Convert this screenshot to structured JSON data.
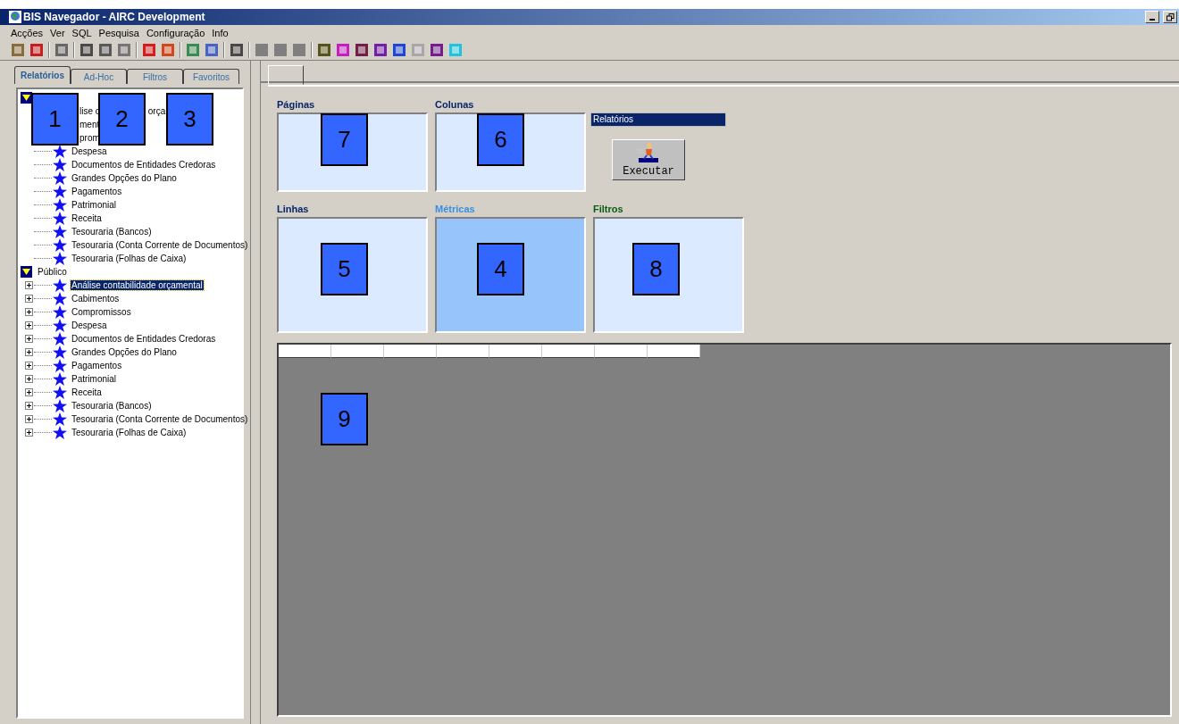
{
  "window": {
    "title": "BIS Navegador - AIRC Development"
  },
  "menu": [
    "Acções",
    "Ver",
    "SQL",
    "Pesquisa",
    "Configuração",
    "Info"
  ],
  "left_tabs": [
    {
      "label": "Relatórios",
      "selected": true
    },
    {
      "label": "Ad-Hoc",
      "selected": false
    },
    {
      "label": "Filtros",
      "selected": false
    },
    {
      "label": "Favoritos",
      "selected": false
    }
  ],
  "tree": [
    {
      "expanded": true,
      "children": [
        {
          "kind": "partial",
          "fragments": [
            "lise c",
            "orça"
          ],
          "selected": false
        },
        {
          "kind": "partial",
          "fragments": [
            "ment"
          ],
          "selected": false
        },
        {
          "kind": "partial",
          "fragments": [
            "prom"
          ],
          "selected": false
        },
        {
          "kind": "report",
          "label": "Despesa",
          "selected": false
        },
        {
          "kind": "report",
          "label": "Documentos de Entidades Credoras",
          "selected": false
        },
        {
          "kind": "report",
          "label": "Grandes Opções do Plano",
          "selected": false
        },
        {
          "kind": "report",
          "label": "Pagamentos",
          "selected": false
        },
        {
          "kind": "report",
          "label": "Patrimonial",
          "selected": false
        },
        {
          "kind": "report",
          "label": "Receita",
          "selected": false
        },
        {
          "kind": "report",
          "label": "Tesouraria (Bancos)",
          "selected": false
        },
        {
          "kind": "report",
          "label": "Tesouraria (Conta Corrente de Documentos)",
          "selected": false
        },
        {
          "kind": "report",
          "label": "Tesouraria (Folhas de Caixa)",
          "selected": false
        }
      ]
    },
    {
      "label": "Público",
      "expanded": true,
      "children": [
        {
          "kind": "report",
          "label": "Análise contabilidade orçamental",
          "selected": true,
          "collapsed": true
        },
        {
          "kind": "report",
          "label": "Cabimentos",
          "selected": false,
          "collapsed": true
        },
        {
          "kind": "report",
          "label": "Compromissos",
          "selected": false,
          "collapsed": true
        },
        {
          "kind": "report",
          "label": "Despesa",
          "selected": false,
          "collapsed": true
        },
        {
          "kind": "report",
          "label": "Documentos de Entidades Credoras",
          "selected": false,
          "collapsed": true
        },
        {
          "kind": "report",
          "label": "Grandes Opções do Plano",
          "selected": false,
          "collapsed": true
        },
        {
          "kind": "report",
          "label": "Pagamentos",
          "selected": false,
          "collapsed": true
        },
        {
          "kind": "report",
          "label": "Patrimonial",
          "selected": false,
          "collapsed": true
        },
        {
          "kind": "report",
          "label": "Receita",
          "selected": false,
          "collapsed": true
        },
        {
          "kind": "report",
          "label": "Tesouraria (Bancos)",
          "selected": false,
          "collapsed": true
        },
        {
          "kind": "report",
          "label": "Tesouraria (Conta Corrente de Documentos)",
          "selected": false,
          "collapsed": true
        },
        {
          "kind": "report",
          "label": "Tesouraria (Folhas de Caixa)",
          "selected": false,
          "collapsed": true
        }
      ]
    }
  ],
  "zones_top": [
    {
      "label": "Páginas",
      "color": "#0a246a",
      "selected": false
    },
    {
      "label": "Colunas",
      "color": "#0a246a",
      "selected": false
    }
  ],
  "report_field": {
    "value": "Relatórios"
  },
  "run_button": {
    "label": "Executar"
  },
  "zones_bottom": [
    {
      "label": "Linhas",
      "color": "#0a246a",
      "selected": false
    },
    {
      "label": "Métricas",
      "color": "#3a8ee0",
      "selected": true
    },
    {
      "label": "Filtros",
      "color": "#0b5a12",
      "selected": false
    }
  ],
  "callouts": [
    {
      "number": "1"
    },
    {
      "number": "2"
    },
    {
      "number": "3"
    },
    {
      "number": "7"
    },
    {
      "number": "6"
    },
    {
      "number": "5"
    },
    {
      "number": "4"
    },
    {
      "number": "8"
    },
    {
      "number": "9"
    }
  ]
}
